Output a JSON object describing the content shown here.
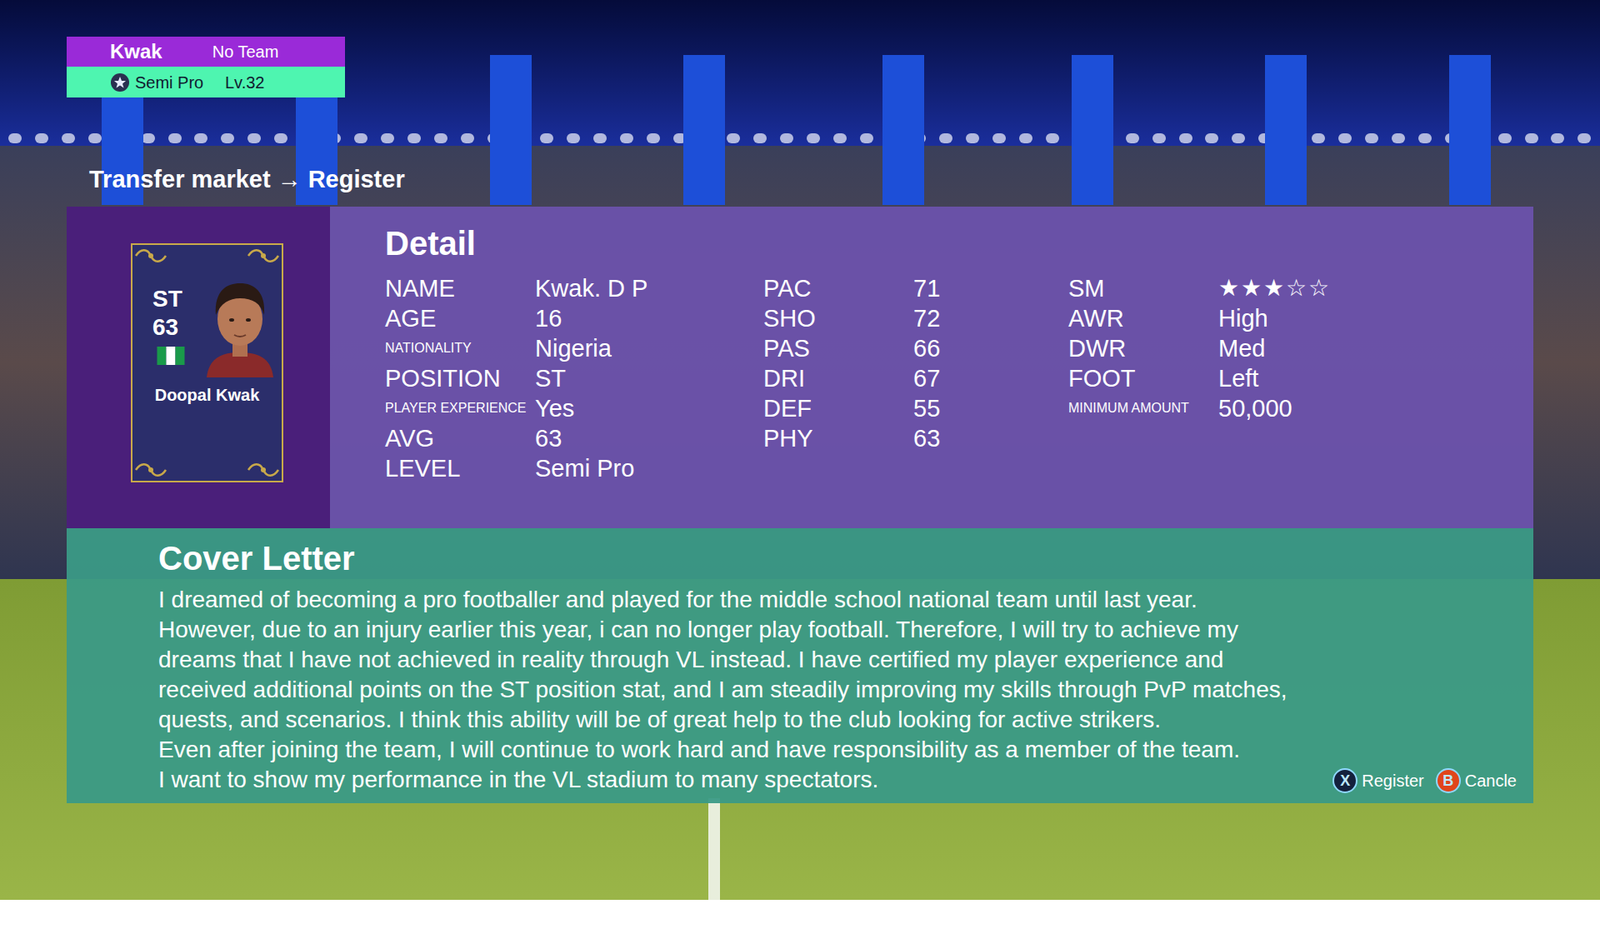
{
  "user": {
    "name": "Kwak",
    "team": "No Team",
    "rank": "Semi Pro",
    "level": "Lv.32"
  },
  "breadcrumb": {
    "from": "Transfer market",
    "arrow": "→",
    "to": "Register"
  },
  "card": {
    "position": "ST",
    "rating": "63",
    "name": "Doopal Kwak"
  },
  "detail": {
    "title": "Detail",
    "groups": [
      [
        {
          "label": "NAME",
          "value": "Kwak. D P",
          "kind": "normal"
        },
        {
          "label": "AGE",
          "value": "16",
          "kind": "normal"
        },
        {
          "label": "NATIONALITY",
          "value": "Nigeria",
          "kind": "small"
        },
        {
          "label": "POSITION",
          "value": "ST",
          "kind": "normal"
        },
        {
          "label": "PLAYER EXPERIENCE",
          "value": "Yes",
          "kind": "small"
        },
        {
          "label": "AVG",
          "value": "63",
          "kind": "normal"
        },
        {
          "label": "LEVEL",
          "value": "Semi Pro",
          "kind": "normal"
        }
      ],
      [
        {
          "label": "PAC",
          "value": "71",
          "kind": "normal"
        },
        {
          "label": "SHO",
          "value": "72",
          "kind": "normal"
        },
        {
          "label": "PAS",
          "value": "66",
          "kind": "normal"
        },
        {
          "label": "DRI",
          "value": "67",
          "kind": "normal"
        },
        {
          "label": "DEF",
          "value": "55",
          "kind": "normal"
        },
        {
          "label": "PHY",
          "value": "63",
          "kind": "normal"
        }
      ],
      [
        {
          "label": "SM",
          "kind": "stars",
          "stars": 3,
          "total": 5,
          "filled": "★",
          "empty": "☆"
        },
        {
          "label": "AWR",
          "value": "High",
          "kind": "normal"
        },
        {
          "label": "DWR",
          "value": "Med",
          "kind": "normal"
        },
        {
          "label": "FOOT",
          "value": "Left",
          "kind": "normal"
        },
        {
          "label": "MINIMUM AMOUNT",
          "value": "50,000",
          "kind": "small"
        }
      ]
    ]
  },
  "cover_letter": {
    "title": "Cover Letter",
    "lines": [
      "I dreamed of becoming a pro footballer and played for the middle school national team until last year.",
      "However, due to an injury earlier this year, i can no longer play football. Therefore, I will try to achieve my",
      "dreams that I have not achieved in reality through VL instead. I have certified my player experience and",
      "received additional points on the ST position stat, and I am steadily improving my skills through PvP matches,",
      "quests, and scenarios. I think this ability will be of great help to the club looking for active strikers.",
      "Even after joining the team, I will continue to work hard and have responsibility as a member of the team.",
      "I want to show my performance in the VL stadium to many spectators."
    ]
  },
  "buttons": [
    {
      "key": "X",
      "label": "Register",
      "color": "#14213d"
    },
    {
      "key": "B",
      "label": "Cancle",
      "color": "#e0451b"
    }
  ]
}
